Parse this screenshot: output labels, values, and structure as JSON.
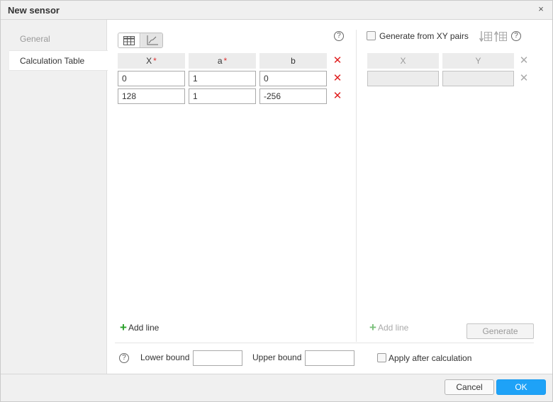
{
  "window": {
    "title": "New sensor",
    "close_glyph": "×"
  },
  "sidebar": {
    "tabs": [
      {
        "label": "General",
        "active": false
      },
      {
        "label": "Calculation Table",
        "active": true
      }
    ]
  },
  "calc_table": {
    "columns": [
      {
        "label": "X",
        "required": true
      },
      {
        "label": "a",
        "required": true
      },
      {
        "label": "b",
        "required": false
      }
    ],
    "required_mark": "*",
    "rows": [
      [
        "0",
        "1",
        "0"
      ],
      [
        "128",
        "1",
        "-256"
      ]
    ],
    "add_line_label": "Add line",
    "help_glyph": "?"
  },
  "xy_pairs": {
    "generate_checkbox_label": "Generate from XY pairs",
    "generate_checked": false,
    "columns": [
      "X",
      "Y"
    ],
    "add_line_label": "Add line",
    "generate_button_label": "Generate"
  },
  "bounds": {
    "lower_label": "Lower bound",
    "lower_value": "",
    "upper_label": "Upper bound",
    "upper_value": "",
    "apply_after_label": "Apply after calculation",
    "apply_after_checked": false
  },
  "footer": {
    "cancel_label": "Cancel",
    "ok_label": "OK"
  },
  "colors": {
    "accent": "#1ea2f7",
    "delete": "#e02020",
    "add": "#2aa02a",
    "required": "#d33333"
  }
}
